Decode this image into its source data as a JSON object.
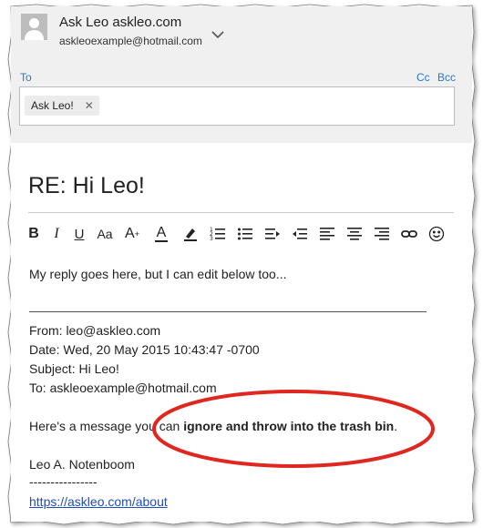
{
  "account": {
    "name": "Ask Leo askleo.com",
    "email": "askleoexample@hotmail.com"
  },
  "recipients": {
    "to_label": "To",
    "cc_label": "Cc",
    "bcc_label": "Bcc",
    "to_chip": "Ask Leo!",
    "chip_remove": "✕"
  },
  "subject": "RE: Hi Leo!",
  "toolbar": {
    "bold": "B",
    "italic": "I",
    "underline": "U",
    "font_size": "Aa",
    "grow_font": "A",
    "font_color": "A"
  },
  "message": {
    "reply": "My reply goes here, but I can edit below too...",
    "from": "From: leo@askleo.com",
    "date": "Date: Wed, 20 May 2015 10:43:47 -0700",
    "subject": "Subject: Hi Leo!",
    "to": "To: askleoexample@hotmail.com",
    "quote_prefix": "Here's a message you can ",
    "quote_bold": "ignore and throw into the trash bin",
    "quote_suffix": ".",
    "signature_name": "Leo A. Notenboom",
    "signature_dashes": "----------------",
    "signature_link": "https://askleo.com/about"
  },
  "colors": {
    "link": "#2b79c2",
    "annotation": "#e0271f",
    "header_bg": "#f0f0f0"
  }
}
